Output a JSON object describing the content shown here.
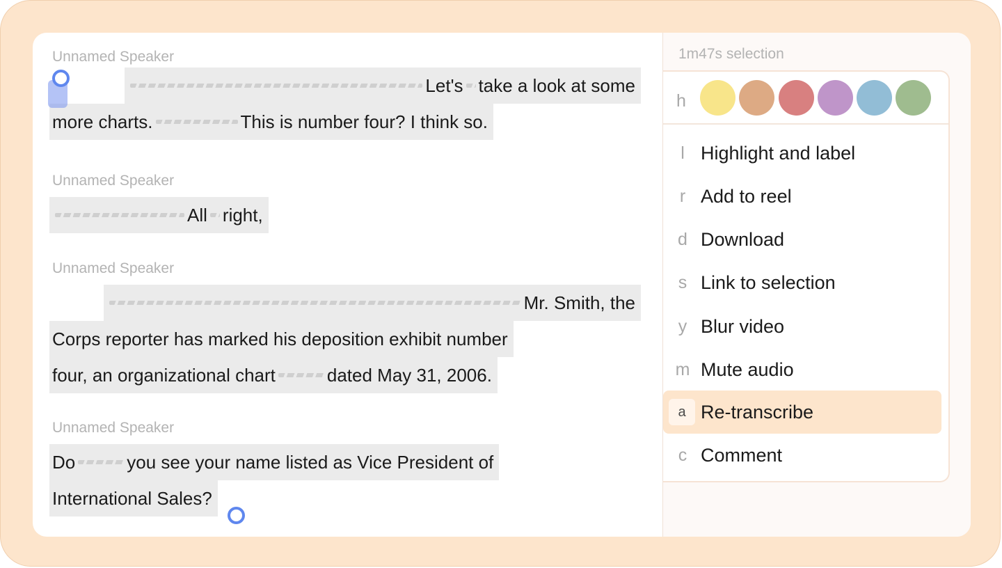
{
  "transcript": {
    "blocks": [
      {
        "speaker": "Unnamed Speaker",
        "line1": {
          "t1": "Let's",
          "t2": "take a look at some"
        },
        "line2": {
          "t1": "more charts.",
          "t2": "This is number four? I think so."
        }
      },
      {
        "speaker": "Unnamed Speaker",
        "line1": {
          "t1": "All",
          "t2": "right,"
        }
      },
      {
        "speaker": "Unnamed Speaker",
        "line1": {
          "t1": "Mr. Smith, the"
        },
        "line2": {
          "t1": "Corps reporter has marked his deposition exhibit number"
        },
        "line3": {
          "t1": "four, an organizational chart",
          "t2": "dated May 31, 2006."
        }
      },
      {
        "speaker": "Unnamed Speaker",
        "line1": {
          "t1": "Do",
          "t2": "you see your name listed as Vice President of"
        },
        "line2": {
          "t1": "International Sales?"
        }
      }
    ]
  },
  "panel": {
    "title": "1m47s selection",
    "highlight_key": "h",
    "swatches": [
      "#f8e58a",
      "#ddaa84",
      "#d88080",
      "#bf95c9",
      "#92bdd6",
      "#9fbc8f"
    ],
    "items": [
      {
        "key": "l",
        "label": "Highlight and label"
      },
      {
        "key": "r",
        "label": "Add to reel"
      },
      {
        "key": "d",
        "label": "Download"
      },
      {
        "key": "s",
        "label": "Link to selection"
      },
      {
        "key": "y",
        "label": "Blur video"
      },
      {
        "key": "m",
        "label": "Mute audio"
      },
      {
        "key": "a",
        "label": "Re-transcribe",
        "active": true
      },
      {
        "key": "c",
        "label": "Comment"
      }
    ]
  }
}
